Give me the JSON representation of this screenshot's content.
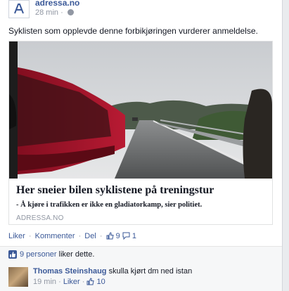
{
  "post": {
    "page_name": "adressa.no",
    "time": "28 min",
    "separator": "·",
    "text": "Syklisten som opplevde denne forbikjøringen vurderer anmeldelse."
  },
  "link_preview": {
    "title": "Her sneier bilen syklistene på treningstur",
    "description": "- Å kjøre i trafikken er ikke en gladiatorkamp, sier politiet.",
    "domain": "ADRESSA.NO"
  },
  "actions": {
    "like": "Liker",
    "comment": "Kommenter",
    "share": "Del",
    "dot": "·",
    "like_count": "9",
    "comment_count": "1"
  },
  "likes_summary": {
    "people": "9 personer",
    "suffix": " liker dette."
  },
  "comment": {
    "author": "Thomas Steinshaug",
    "text": "skulla kjørt dm ned istan",
    "time": "19 min",
    "like": "Liker",
    "like_count": "10",
    "dot": "·"
  },
  "colors": {
    "link": "#3b5998",
    "meta": "#9197a3",
    "car": "#a3142a"
  }
}
